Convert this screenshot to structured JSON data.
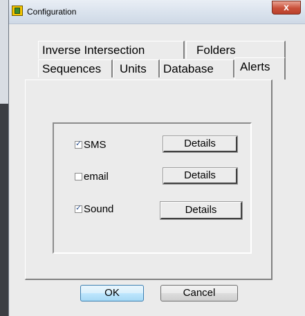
{
  "window": {
    "title": "Configuration",
    "close_glyph": "x"
  },
  "tabs": {
    "row1": [
      "Inverse Intersection",
      "Folders"
    ],
    "row2": [
      "Sequences",
      "Units",
      "Database",
      "Alerts"
    ],
    "active": "Alerts"
  },
  "alerts": {
    "items": [
      {
        "label": "SMS",
        "checked": true,
        "button": "Details"
      },
      {
        "label": "email",
        "checked": false,
        "button": "Details"
      },
      {
        "label": "Sound",
        "checked": true,
        "button": "Details"
      }
    ]
  },
  "footer": {
    "ok_label": "OK",
    "cancel_label": "Cancel"
  }
}
